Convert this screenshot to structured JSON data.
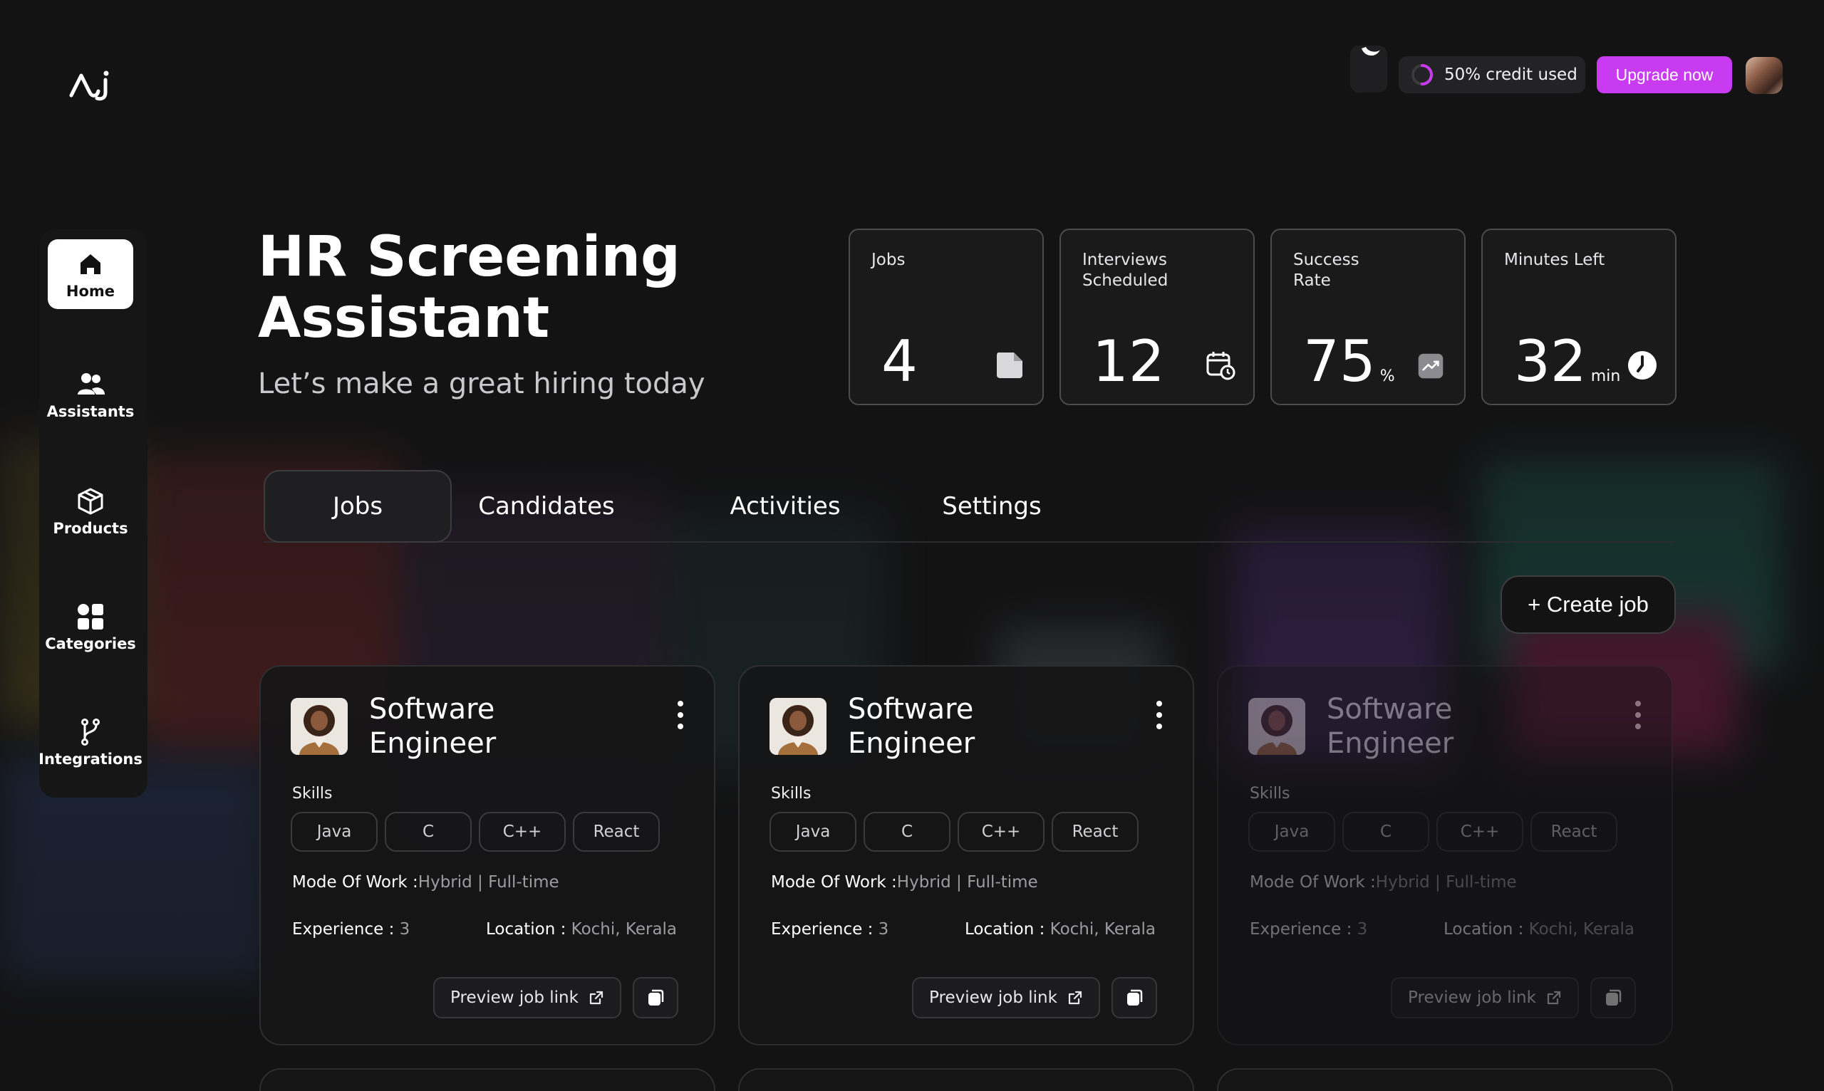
{
  "header": {
    "credit_text": "50% credit used",
    "credit_percent": 0.5,
    "upgrade_label": "Upgrade now"
  },
  "sidebar": {
    "items": [
      {
        "label": "Home",
        "icon": "home-icon",
        "active": true
      },
      {
        "label": "Assistants",
        "icon": "users-icon"
      },
      {
        "label": "Products",
        "icon": "box-icon"
      },
      {
        "label": "Categories",
        "icon": "grid-icon"
      },
      {
        "label": "Integrations",
        "icon": "branch-icon"
      }
    ]
  },
  "hero": {
    "title": "HR Screening Assistant",
    "subtitle": "Let’s make a great hiring today"
  },
  "stats": [
    {
      "label": "Jobs",
      "value": "4",
      "unit": "",
      "icon": "document-icon"
    },
    {
      "label": "Interviews Scheduled",
      "value": "12",
      "unit": "",
      "icon": "calendar-clock-icon"
    },
    {
      "label": "Success Rate",
      "value": "75",
      "unit": "%",
      "icon": "trend-up-icon"
    },
    {
      "label": "Minutes Left",
      "value": "32",
      "unit": "min",
      "icon": "clock-icon"
    }
  ],
  "tabs": [
    {
      "label": "Jobs",
      "active": true
    },
    {
      "label": "Candidates"
    },
    {
      "label": "Activities"
    },
    {
      "label": "Settings"
    }
  ],
  "create_job_label": "+ Create job",
  "jobs": [
    {
      "title": "Software Engineer",
      "skills_label": "Skills",
      "skills": [
        "Java",
        "C",
        "C++",
        "React"
      ],
      "mode_label": "Mode Of Work :",
      "mode_value": "Hybrid | Full-time",
      "experience_label": "Experience :",
      "experience_value": "3",
      "location_label": "Location :",
      "location_value": "Kochi, Kerala",
      "preview_label": "Preview job link"
    },
    {
      "title": "Software Engineer",
      "skills_label": "Skills",
      "skills": [
        "Java",
        "C",
        "C++",
        "React"
      ],
      "mode_label": "Mode Of Work :",
      "mode_value": "Hybrid | Full-time",
      "experience_label": "Experience :",
      "experience_value": "3",
      "location_label": "Location :",
      "location_value": "Kochi, Kerala",
      "preview_label": "Preview job link"
    },
    {
      "title": "Software Engineer",
      "skills_label": "Skills",
      "skills": [
        "Java",
        "C",
        "C++",
        "React"
      ],
      "mode_label": "Mode Of Work :",
      "mode_value": "Hybrid | Full-time",
      "experience_label": "Experience :",
      "experience_value": "3",
      "location_label": "Location :",
      "location_value": "Kochi, Kerala",
      "preview_label": "Preview job link"
    }
  ],
  "colors": {
    "background": "#131314",
    "accent": "#c83bf0",
    "card": "#1a1a1b"
  }
}
